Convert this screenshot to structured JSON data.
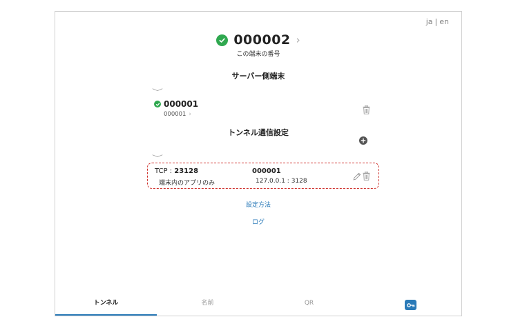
{
  "lang": {
    "ja": "ja",
    "sep": "|",
    "en": "en"
  },
  "device": {
    "id": "000002",
    "subtitle": "この端末の番号"
  },
  "server_section": {
    "title": "サーバー側端末"
  },
  "server": {
    "id": "000001",
    "sub_id": "000001"
  },
  "tunnel_section": {
    "title": "トンネル通信設定"
  },
  "tunnel": {
    "proto_label": "TCP : ",
    "port": "23128",
    "server_id": "000001",
    "scope": "端末内のアプリのみ",
    "target": "127.0.0.1 : 3128"
  },
  "links": {
    "setup": "設定方法",
    "log": "ログ"
  },
  "tabs": [
    {
      "label": "トンネル"
    },
    {
      "label": "名前"
    },
    {
      "label": "QR"
    }
  ],
  "colors": {
    "accent": "#2a7ab8",
    "ok": "#2fa84f",
    "highlight": "#d0322d"
  }
}
